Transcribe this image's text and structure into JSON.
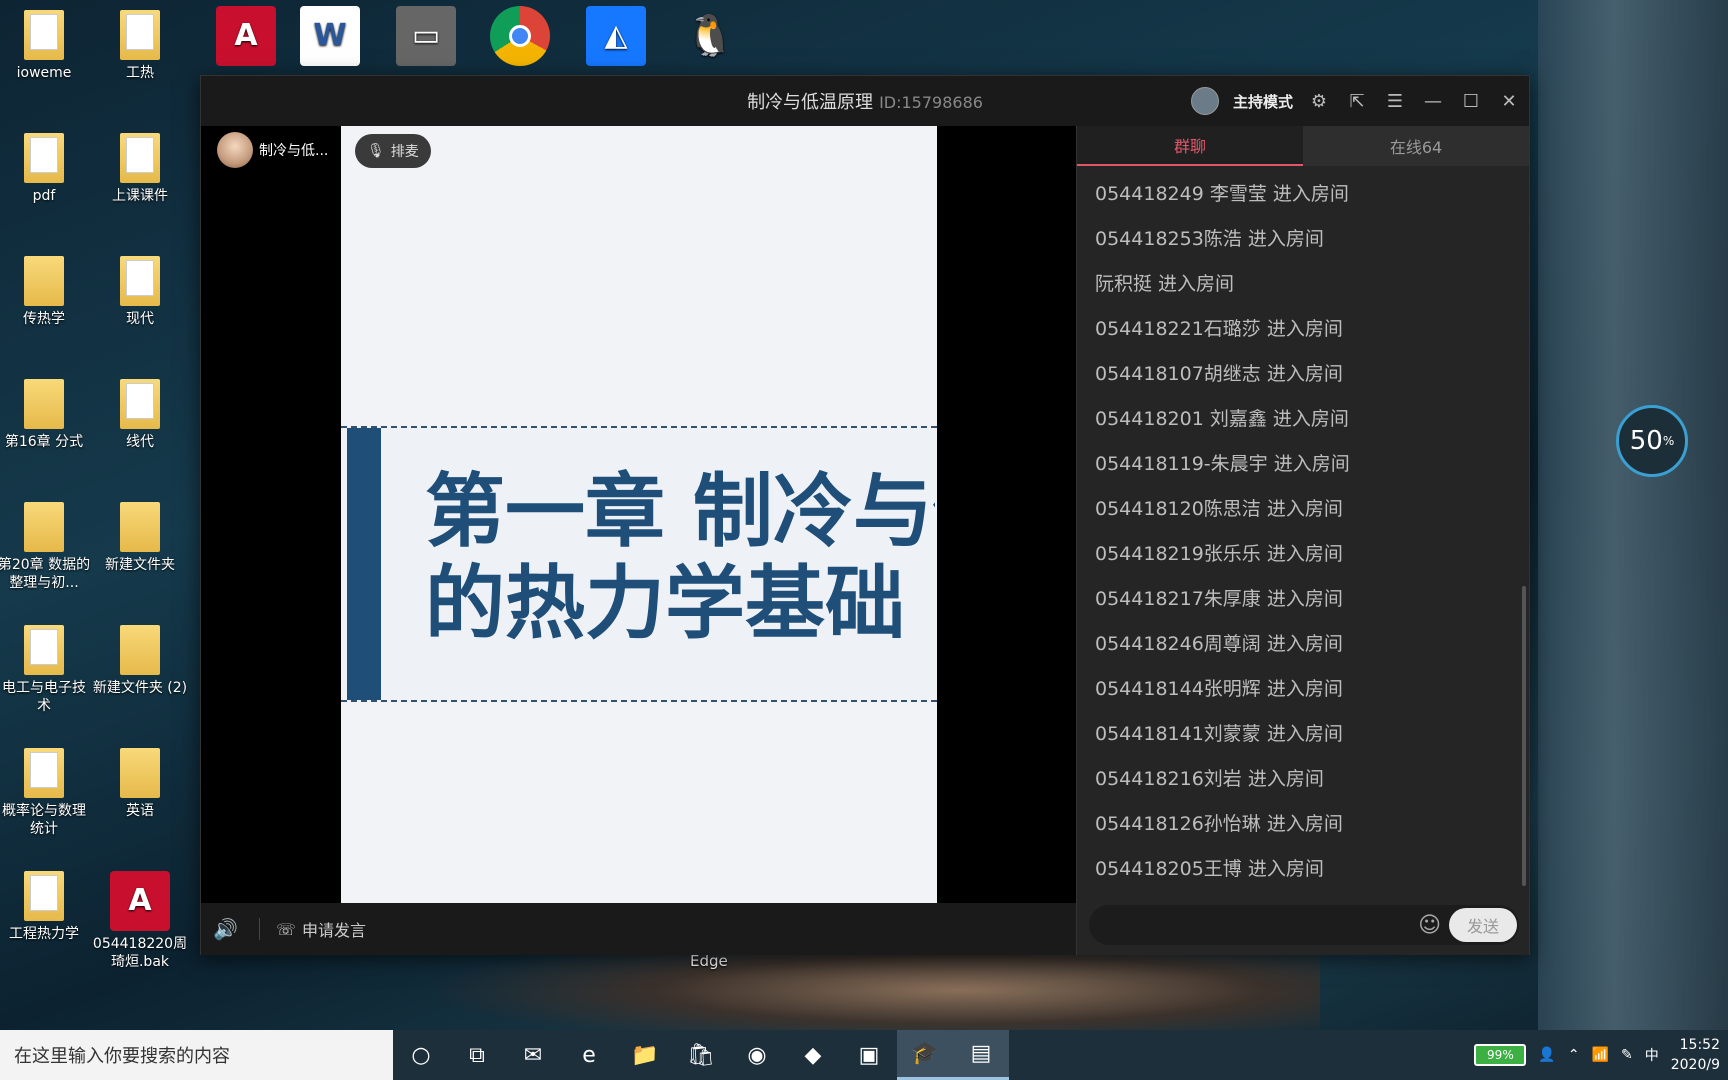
{
  "desktop": {
    "icons": [
      {
        "label": "ioweme",
        "kind": "folder-doc"
      },
      {
        "label": "工热",
        "kind": "folder-doc"
      },
      {
        "label": "pdf",
        "kind": "folder-doc"
      },
      {
        "label": "上课课件",
        "kind": "folder-doc"
      },
      {
        "label": "传热学",
        "kind": "folder"
      },
      {
        "label": "现代",
        "kind": "folder-doc"
      },
      {
        "label": "第16章 分式",
        "kind": "folder"
      },
      {
        "label": "线代",
        "kind": "folder-doc"
      },
      {
        "label": "第20章 数据的整理与初...",
        "kind": "folder"
      },
      {
        "label": "新建文件夹",
        "kind": "folder"
      },
      {
        "label": "电工与电子技术",
        "kind": "folder-doc"
      },
      {
        "label": "新建文件夹 (2)",
        "kind": "folder"
      },
      {
        "label": "概率论与数理统计",
        "kind": "folder-doc"
      },
      {
        "label": "英语",
        "kind": "folder"
      },
      {
        "label": "工程热力学",
        "kind": "folder-doc"
      },
      {
        "label": "054418220周琦烜.bak",
        "kind": "autocad"
      }
    ],
    "edge_label": "Edge"
  },
  "window": {
    "title": "制冷与低温原理",
    "room_id": "ID:15798686",
    "host_mode_label": "主持模式"
  },
  "video": {
    "presenter_name": "制冷与低...",
    "queue_label": "排麦",
    "slide_title": "第一章 制冷与低\n的热力学基础",
    "apply_speak_label": "申请发言"
  },
  "chat": {
    "tabs": [
      {
        "label": "群聊",
        "active": true
      },
      {
        "label": "在线64",
        "active": false
      }
    ],
    "messages": [
      "054418249 李雪莹 进入房间",
      "054418253陈浩 进入房间",
      "阮积挺 进入房间",
      "054418221石璐莎 进入房间",
      "054418107胡继志 进入房间",
      "054418201 刘嘉鑫 进入房间",
      "054418119-朱晨宇 进入房间",
      "054418120陈思洁 进入房间",
      "054418219张乐乐 进入房间",
      "054418217朱厚康 进入房间",
      "054418246周尊阔 进入房间",
      "054418144张明辉 进入房间",
      "054418141刘蒙蒙 进入房间",
      "054418216刘岩 进入房间",
      "054418126孙怡琳 进入房间",
      "054418205王博 进入房间"
    ],
    "input_value": "",
    "send_label": "发送"
  },
  "meter": {
    "value": "50",
    "unit": "%"
  },
  "taskbar": {
    "search_placeholder": "在这里输入你要搜索的内容",
    "battery": "99%",
    "ime": "中",
    "time": "15:52",
    "date": "2020/9"
  },
  "colors": {
    "accent": "#e0576a",
    "slide_blue": "#1f4e79"
  }
}
